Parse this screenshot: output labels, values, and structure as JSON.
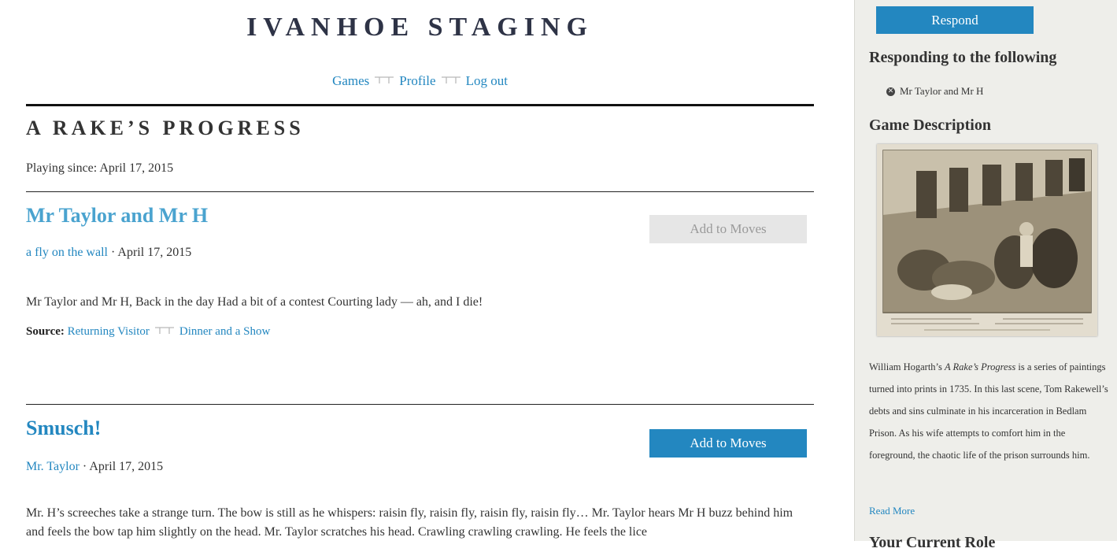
{
  "site": {
    "title": "IVANHOE STAGING"
  },
  "nav": {
    "items": [
      "Games",
      "Profile",
      "Log out"
    ]
  },
  "game": {
    "title": "A RAKE’S PROGRESS",
    "playing_since": "Playing since: April 17, 2015"
  },
  "posts": [
    {
      "title": "Mr Taylor and Mr H",
      "author": "a fly on the wall",
      "date": "· April 17, 2015",
      "button": "Add to Moves",
      "button_state": "disabled",
      "body": "Mr Taylor and Mr H, Back in the day Had a bit of a contest Courting lady — ah, and I die!",
      "source_label": "Source:",
      "sources": [
        "Returning Visitor",
        "Dinner and a Show"
      ]
    },
    {
      "title": "Smusch!",
      "author": "Mr. Taylor",
      "date": "· April 17, 2015",
      "button": "Add to Moves",
      "button_state": "enabled",
      "body": "Mr. H’s screeches take a strange turn. The bow is still as he whispers: raisin fly, raisin fly, raisin fly, raisin fly… Mr. Taylor hears Mr H buzz behind him and feels the bow tap him slightly on the head. Mr. Taylor scratches his head. Crawling crawling crawling. He feels the lice"
    }
  ],
  "sidebar": {
    "respond_label": "Respond",
    "responding_heading": "Responding to the following",
    "responding_item": "Mr Taylor and Mr H",
    "description_heading": "Game Description",
    "description_pre": "William Hogarth’s ",
    "description_em": "A Rake’s Progress",
    "description_post": " is a series of paintings turned into prints in 1735. In this last scene, Tom Rakewell’s debts and sins culminate in his incarceration in Bedlam Prison. As his wife attempts to comfort him in the foreground, the chaotic life of the prison surrounds him.",
    "read_more": "Read More",
    "cut_heading": "Your Current Role"
  },
  "colors": {
    "link": "#2387c0",
    "sidebar_bg": "#eeeeea",
    "title": "#2e3346"
  }
}
